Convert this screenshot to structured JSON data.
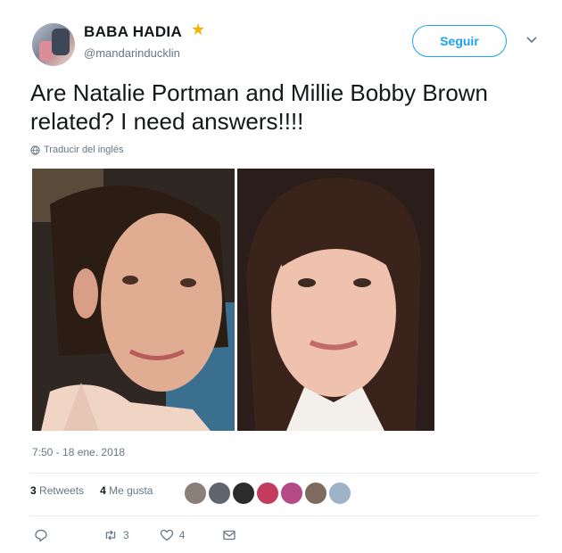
{
  "user": {
    "name": "BABA HADIA",
    "badge_icon": "star-icon",
    "handle": "@mandarinducklin"
  },
  "follow_button": {
    "label": "Seguir"
  },
  "menu": {
    "icon": "chevron-down-icon"
  },
  "tweet": {
    "text": "Are Natalie Portman and Millie Bobby Brown related? I need answers!!!!",
    "translate_label": "Traducir del inglés",
    "timestamp": "7:50 - 18 ene. 2018"
  },
  "stats": {
    "retweets_count": "3",
    "retweets_label": "Retweets",
    "likes_count": "4",
    "likes_label": "Me gusta"
  },
  "likers": [
    {
      "color": "#8a7f79"
    },
    {
      "color": "#5f6670"
    },
    {
      "color": "#2b2b2b"
    },
    {
      "color": "#c23c5e"
    },
    {
      "color": "#b44a86"
    },
    {
      "color": "#7f6a5e"
    },
    {
      "color": "#9fb3c8"
    }
  ],
  "actions": {
    "reply_icon": "reply-icon",
    "retweet_icon": "retweet-icon",
    "retweet_count": "3",
    "like_icon": "heart-icon",
    "like_count": "4",
    "message_icon": "envelope-icon"
  },
  "colors": {
    "accent": "#1da1f2",
    "secondary_text": "#657786",
    "divider": "#e6ecf0"
  }
}
